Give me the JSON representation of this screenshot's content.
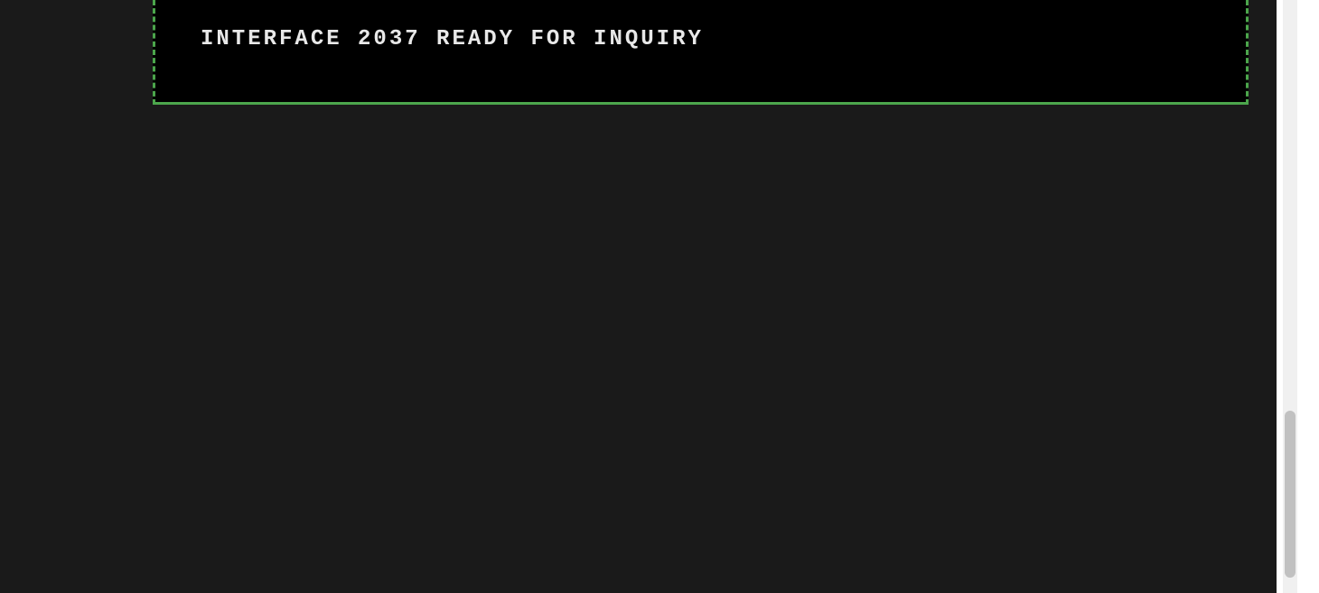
{
  "terminal": {
    "status_line": "INTERFACE 2037 READY FOR INQUIRY"
  },
  "colors": {
    "terminal_bg": "#000000",
    "page_bg": "#1a1a1a",
    "border_green": "#4ca64c",
    "text_light": "#e8e8e8",
    "scrollbar_track": "#f0f0f0",
    "scrollbar_thumb": "#c1c1c1"
  }
}
